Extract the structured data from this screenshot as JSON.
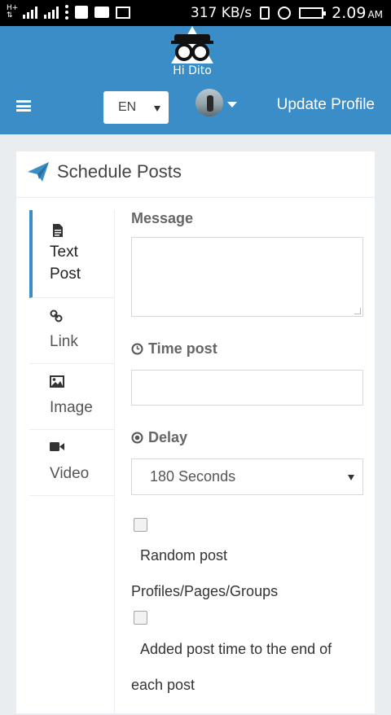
{
  "status_bar": {
    "speed": "317 KB/s",
    "time": "2.09",
    "ampm": "AM",
    "icons": [
      "h-plus-icon",
      "signal-icon",
      "signal-icon",
      "more-vert-icon",
      "square-icon",
      "message-icon",
      "image-icon",
      "vibrate-icon",
      "alarm-icon",
      "battery-charging-icon"
    ]
  },
  "header": {
    "logo_text": "Hi Dito",
    "language": "EN",
    "update_profile": "Update Profile",
    "colors": {
      "bar": "#3b8dc7",
      "accent": "#3b8dc7"
    }
  },
  "card": {
    "title": "Schedule Posts",
    "tabs": [
      {
        "line1": "Text",
        "line2": "Post",
        "icon": "file-text-icon",
        "active": true
      },
      {
        "line1": "Link",
        "icon": "link-icon"
      },
      {
        "line1": "Image",
        "icon": "image-icon"
      },
      {
        "line1": "Video",
        "icon": "video-camera-icon"
      }
    ],
    "form": {
      "message_label": "Message",
      "message_value": "",
      "time_label": "Time post",
      "time_value": "",
      "delay_label": "Delay",
      "delay_selected": "180 Seconds",
      "random_label_1": "Random post",
      "random_label_2": "Profiles/Pages/Groups",
      "added_label_1": "Added post time to the end of",
      "added_label_2": "each post"
    }
  }
}
